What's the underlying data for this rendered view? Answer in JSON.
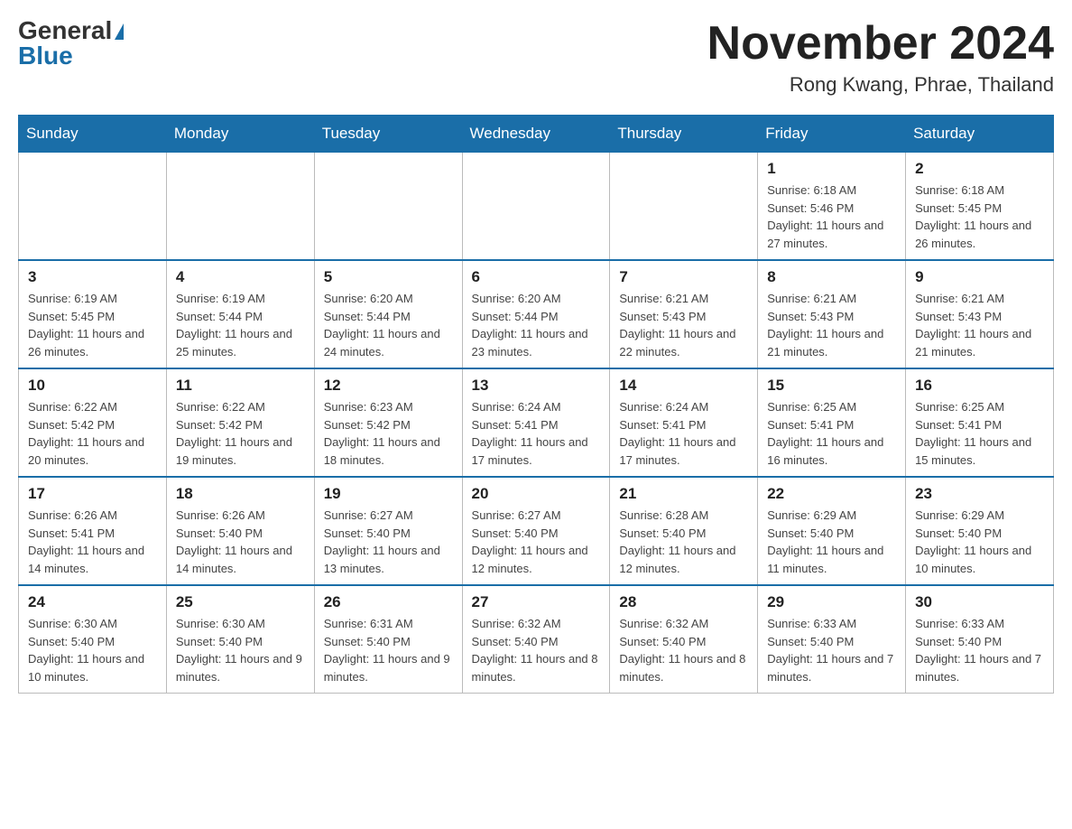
{
  "header": {
    "logo_general": "General",
    "logo_blue": "Blue",
    "month_title": "November 2024",
    "location": "Rong Kwang, Phrae, Thailand"
  },
  "days_of_week": [
    "Sunday",
    "Monday",
    "Tuesday",
    "Wednesday",
    "Thursday",
    "Friday",
    "Saturday"
  ],
  "weeks": [
    [
      {
        "day": "",
        "info": ""
      },
      {
        "day": "",
        "info": ""
      },
      {
        "day": "",
        "info": ""
      },
      {
        "day": "",
        "info": ""
      },
      {
        "day": "",
        "info": ""
      },
      {
        "day": "1",
        "info": "Sunrise: 6:18 AM\nSunset: 5:46 PM\nDaylight: 11 hours and 27 minutes."
      },
      {
        "day": "2",
        "info": "Sunrise: 6:18 AM\nSunset: 5:45 PM\nDaylight: 11 hours and 26 minutes."
      }
    ],
    [
      {
        "day": "3",
        "info": "Sunrise: 6:19 AM\nSunset: 5:45 PM\nDaylight: 11 hours and 26 minutes."
      },
      {
        "day": "4",
        "info": "Sunrise: 6:19 AM\nSunset: 5:44 PM\nDaylight: 11 hours and 25 minutes."
      },
      {
        "day": "5",
        "info": "Sunrise: 6:20 AM\nSunset: 5:44 PM\nDaylight: 11 hours and 24 minutes."
      },
      {
        "day": "6",
        "info": "Sunrise: 6:20 AM\nSunset: 5:44 PM\nDaylight: 11 hours and 23 minutes."
      },
      {
        "day": "7",
        "info": "Sunrise: 6:21 AM\nSunset: 5:43 PM\nDaylight: 11 hours and 22 minutes."
      },
      {
        "day": "8",
        "info": "Sunrise: 6:21 AM\nSunset: 5:43 PM\nDaylight: 11 hours and 21 minutes."
      },
      {
        "day": "9",
        "info": "Sunrise: 6:21 AM\nSunset: 5:43 PM\nDaylight: 11 hours and 21 minutes."
      }
    ],
    [
      {
        "day": "10",
        "info": "Sunrise: 6:22 AM\nSunset: 5:42 PM\nDaylight: 11 hours and 20 minutes."
      },
      {
        "day": "11",
        "info": "Sunrise: 6:22 AM\nSunset: 5:42 PM\nDaylight: 11 hours and 19 minutes."
      },
      {
        "day": "12",
        "info": "Sunrise: 6:23 AM\nSunset: 5:42 PM\nDaylight: 11 hours and 18 minutes."
      },
      {
        "day": "13",
        "info": "Sunrise: 6:24 AM\nSunset: 5:41 PM\nDaylight: 11 hours and 17 minutes."
      },
      {
        "day": "14",
        "info": "Sunrise: 6:24 AM\nSunset: 5:41 PM\nDaylight: 11 hours and 17 minutes."
      },
      {
        "day": "15",
        "info": "Sunrise: 6:25 AM\nSunset: 5:41 PM\nDaylight: 11 hours and 16 minutes."
      },
      {
        "day": "16",
        "info": "Sunrise: 6:25 AM\nSunset: 5:41 PM\nDaylight: 11 hours and 15 minutes."
      }
    ],
    [
      {
        "day": "17",
        "info": "Sunrise: 6:26 AM\nSunset: 5:41 PM\nDaylight: 11 hours and 14 minutes."
      },
      {
        "day": "18",
        "info": "Sunrise: 6:26 AM\nSunset: 5:40 PM\nDaylight: 11 hours and 14 minutes."
      },
      {
        "day": "19",
        "info": "Sunrise: 6:27 AM\nSunset: 5:40 PM\nDaylight: 11 hours and 13 minutes."
      },
      {
        "day": "20",
        "info": "Sunrise: 6:27 AM\nSunset: 5:40 PM\nDaylight: 11 hours and 12 minutes."
      },
      {
        "day": "21",
        "info": "Sunrise: 6:28 AM\nSunset: 5:40 PM\nDaylight: 11 hours and 12 minutes."
      },
      {
        "day": "22",
        "info": "Sunrise: 6:29 AM\nSunset: 5:40 PM\nDaylight: 11 hours and 11 minutes."
      },
      {
        "day": "23",
        "info": "Sunrise: 6:29 AM\nSunset: 5:40 PM\nDaylight: 11 hours and 10 minutes."
      }
    ],
    [
      {
        "day": "24",
        "info": "Sunrise: 6:30 AM\nSunset: 5:40 PM\nDaylight: 11 hours and 10 minutes."
      },
      {
        "day": "25",
        "info": "Sunrise: 6:30 AM\nSunset: 5:40 PM\nDaylight: 11 hours and 9 minutes."
      },
      {
        "day": "26",
        "info": "Sunrise: 6:31 AM\nSunset: 5:40 PM\nDaylight: 11 hours and 9 minutes."
      },
      {
        "day": "27",
        "info": "Sunrise: 6:32 AM\nSunset: 5:40 PM\nDaylight: 11 hours and 8 minutes."
      },
      {
        "day": "28",
        "info": "Sunrise: 6:32 AM\nSunset: 5:40 PM\nDaylight: 11 hours and 8 minutes."
      },
      {
        "day": "29",
        "info": "Sunrise: 6:33 AM\nSunset: 5:40 PM\nDaylight: 11 hours and 7 minutes."
      },
      {
        "day": "30",
        "info": "Sunrise: 6:33 AM\nSunset: 5:40 PM\nDaylight: 11 hours and 7 minutes."
      }
    ]
  ]
}
